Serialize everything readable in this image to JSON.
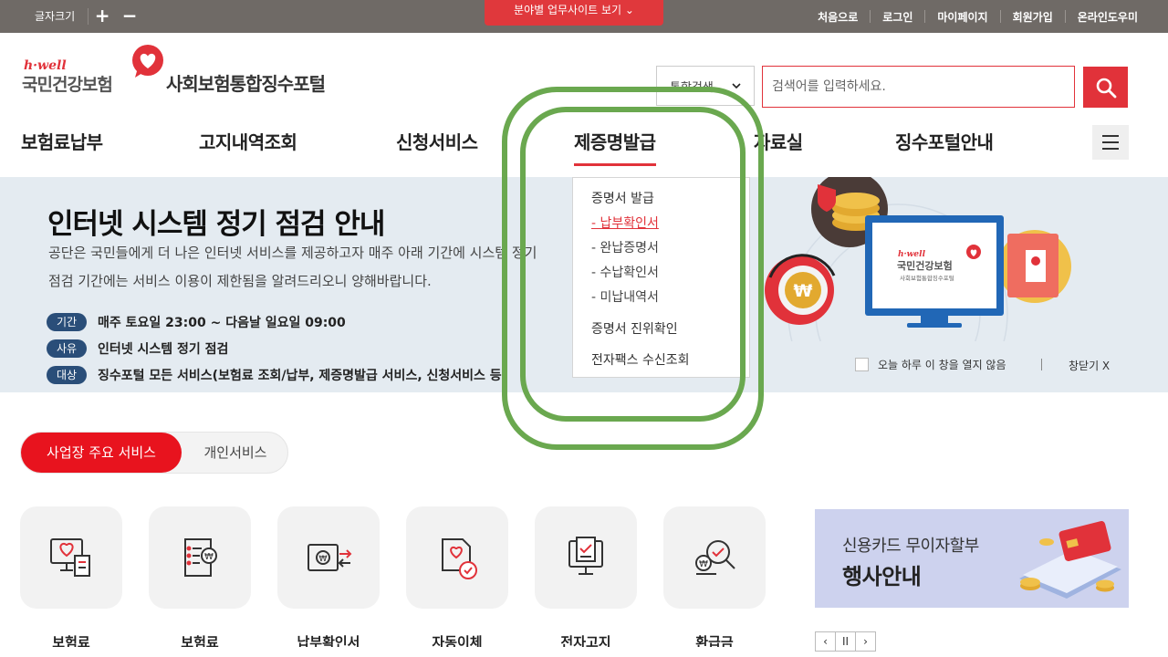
{
  "topbar": {
    "font_size_label": "글자크기",
    "increase": "+",
    "decrease": "−",
    "biz_site_label": "분야별 업무사이트 보기 ⌄",
    "links": [
      "처음으로",
      "로그인",
      "마이페이지",
      "회원가입",
      "온라인도우미"
    ]
  },
  "header": {
    "logo_hwell": "h·well",
    "logo_name": "국민건강보험",
    "portal_title": "사회보험통합징수포털",
    "search_scope": "통합검색",
    "search_placeholder": "검색어를 입력하세요."
  },
  "gnb": {
    "items": [
      "보험료납부",
      "고지내역조회",
      "신청서비스",
      "제증명발급",
      "자료실",
      "징수포털안내"
    ],
    "active": "제증명발급"
  },
  "dropdown": {
    "group1": "증명서 발급",
    "subs": [
      "- 납부확인서",
      "- 완납증명서",
      "- 수납확인서",
      "- 미납내역서"
    ],
    "group2": "증명서 진위확인",
    "group3": "전자팩스 수신조회"
  },
  "banner": {
    "title": "인터넷 시스템 정기 점검 안내",
    "desc1": "공단은 국민들에게 더 나은 인터넷 서비스를 제공하고자 매주 아래 기간에 시스템 정기",
    "desc2": "점검 기간에는 서비스 이용이 제한됨을 알려드리오니 양해바랍니다.",
    "rows": [
      {
        "tag": "기간",
        "text": "매주 토요일 23:00 ~ 다음날 일요일 09:00"
      },
      {
        "tag": "사유",
        "text": "인터넷 시스템 정기 점검"
      },
      {
        "tag": "대상",
        "text": "징수포털 모든 서비스(보험료 조회/납부, 제증명발급 서비스, 신청서비스 등"
      }
    ],
    "illust_hwell": "h·well",
    "illust_name": "국민건강보험",
    "illust_sub": "사회보험통합징수포털",
    "no_show": "오늘 하루 이 창을 열지 않음",
    "close": "창닫기 X"
  },
  "tabs": {
    "business": "사업장 주요 서비스",
    "personal": "개인서비스"
  },
  "services": [
    "보험료",
    "보험료",
    "납부확인서",
    "자동이체",
    "전자고지",
    "환급금"
  ],
  "promo": {
    "line1": "신용카드 무이자할부",
    "line2": "행사안내"
  },
  "pager": {
    "prev": "‹",
    "pause": "II",
    "next": "›"
  },
  "colors": {
    "brand_red": "#e1323a",
    "annotation_green": "#6aa84f",
    "banner_bg": "#e4ebf1",
    "tag_blue": "#2a4e79"
  }
}
